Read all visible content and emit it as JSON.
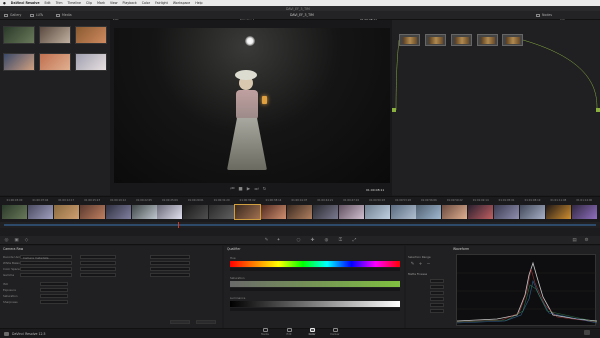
{
  "menubar": {
    "app": "DaVinci Resolve",
    "items": [
      "Edit",
      "Trim",
      "Timeline",
      "Clip",
      "Mark",
      "View",
      "Playback",
      "Color",
      "Fairlight",
      "Workspace",
      "Help"
    ]
  },
  "window_title": "DAVI_EF_3_TIM",
  "toolbar": {
    "gallery": "Gallery",
    "luts": "LUTs",
    "media_pool": "Media",
    "clip_name": "DAVI_EF_3_TIM",
    "timeline_label": "Timeline 1",
    "timecode_top": "01:00:08:11",
    "zoom": "50%",
    "nodes": "Nodes",
    "clip_label": "Clip"
  },
  "viewer": {
    "timecode": "01:00:08:11"
  },
  "timeline_clips": [
    {
      "num": "01",
      "tc": "01:00:03:00"
    },
    {
      "num": "02",
      "tc": "01:00:07:04"
    },
    {
      "num": "03",
      "tc": "01:00:12:17"
    },
    {
      "num": "04",
      "tc": "01:00:15:23"
    },
    {
      "num": "05",
      "tc": "01:00:19:12"
    },
    {
      "num": "06",
      "tc": "01:00:22:05"
    },
    {
      "num": "07",
      "tc": "01:00:25:09"
    },
    {
      "num": "08",
      "tc": "01:00:29:01"
    },
    {
      "num": "09",
      "tc": "01:00:31:20"
    },
    {
      "num": "10",
      "tc": "01:00:35:02"
    },
    {
      "num": "11",
      "tc": "01:00:38:14"
    },
    {
      "num": "12",
      "tc": "01:00:41:07"
    },
    {
      "num": "13",
      "tc": "01:00:44:21"
    },
    {
      "num": "14",
      "tc": "01:00:47:10"
    },
    {
      "num": "15",
      "tc": "01:00:50:03"
    },
    {
      "num": "16",
      "tc": "01:00:53:18"
    },
    {
      "num": "17",
      "tc": "01:00:56:06"
    },
    {
      "num": "18",
      "tc": "01:00:59:22"
    },
    {
      "num": "19",
      "tc": "01:01:02:14"
    },
    {
      "num": "20",
      "tc": "01:01:05:01"
    },
    {
      "num": "21",
      "tc": "01:01:08:19"
    },
    {
      "num": "22",
      "tc": "01:01:11:08"
    },
    {
      "num": "23",
      "tc": "01:01:14:00"
    }
  ],
  "camera_raw": {
    "title": "Camera Raw",
    "decode_using": "Decode Using",
    "decode_value": "Camera metadata",
    "white_balance": "White Balance",
    "color_space": "Color Space",
    "gamma": "Gamma",
    "iso": "ISO",
    "exposure": "Exposure",
    "saturation": "Saturation",
    "sharpness": "Sharpness"
  },
  "qualifier": {
    "title": "Qualifier",
    "hue": "Hue",
    "saturation": "Saturation",
    "luminance": "Luminance"
  },
  "sizing": {
    "title": "Selection Range",
    "matte_finesse": "Matte Finesse"
  },
  "scopes": {
    "title": "Waveform"
  },
  "statusbar": {
    "app_version": "DaVinci Resolve 12.5"
  },
  "pages": [
    {
      "label": "Media"
    },
    {
      "label": "Edit"
    },
    {
      "label": "Color"
    },
    {
      "label": "Deliver"
    }
  ],
  "colors": {
    "accent": "#d0a040",
    "playhead": "#d03a2a",
    "node_link": "#8ab040"
  },
  "icons": [
    "apple-icon",
    "play-icon",
    "stop-icon",
    "prev-icon",
    "next-icon",
    "loop-icon",
    "picker-icon",
    "gear-icon"
  ]
}
